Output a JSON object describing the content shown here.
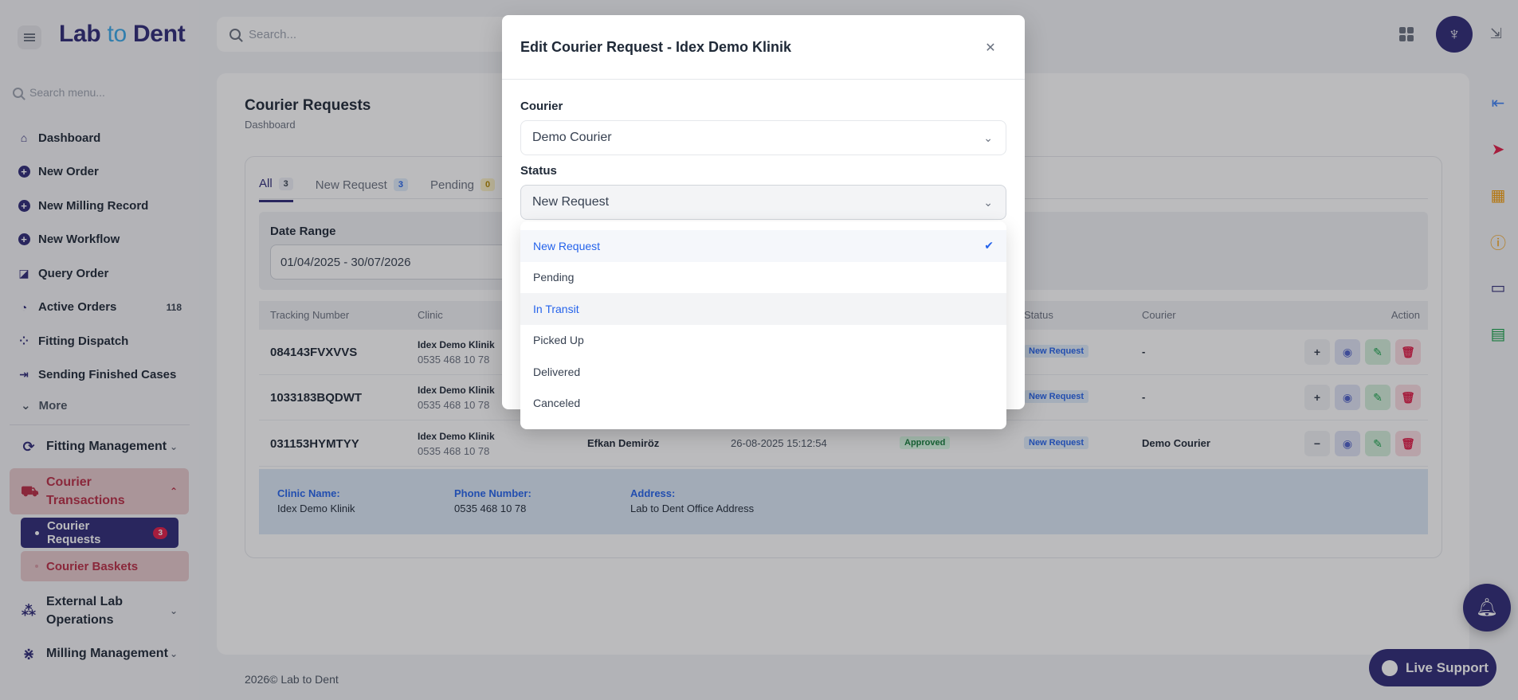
{
  "app": {
    "logo_main": "Lab ",
    "logo_to": "to",
    "logo_end": " Dent",
    "top_search_placeholder": "Search...",
    "avatar_icon": "tooth-icon"
  },
  "sidebar": {
    "search_placeholder": "Search menu...",
    "items": [
      {
        "label": "Dashboard",
        "icon": "home-icon"
      },
      {
        "label": "New Order",
        "icon": "plus-icon"
      },
      {
        "label": "New Milling Record",
        "icon": "plus-icon"
      },
      {
        "label": "New Workflow",
        "icon": "plus-icon"
      },
      {
        "label": "Query Order",
        "icon": "query-icon"
      },
      {
        "label": "Active Orders",
        "icon": "active-icon",
        "count": "118"
      },
      {
        "label": "Fitting Dispatch",
        "icon": "dispatch-icon"
      },
      {
        "label": "Sending Finished Cases",
        "icon": "send-icon"
      }
    ],
    "more_label": "More",
    "sections": {
      "fitting": "Fitting Management",
      "courier": "Courier Transactions",
      "external": "External Lab Operations",
      "milling": "Milling Management"
    },
    "courier_sub": {
      "requests": "Courier Requests",
      "requests_badge": "3",
      "baskets": "Courier Baskets"
    }
  },
  "page": {
    "title": "Courier Requests",
    "breadcrumb": "Dashboard",
    "tabs": [
      {
        "label": "All",
        "count": "3"
      },
      {
        "label": "New Request",
        "count": "3"
      },
      {
        "label": "Pending",
        "count": "0"
      }
    ],
    "filter": {
      "label": "Date Range",
      "value": "01/04/2025 - 30/07/2026"
    },
    "columns": {
      "tracking": "Tracking Number",
      "clinic": "Clinic",
      "status": "Status",
      "courier": "Courier",
      "action": "Action"
    },
    "rows": [
      {
        "tracking": "084143FVXVVS",
        "clinic": "Idex Demo Klinik",
        "phone": "0535 468 10 78",
        "status": "New Request",
        "courier": "-",
        "toggle": "+"
      },
      {
        "tracking": "1033183BQDWT",
        "clinic": "Idex Demo Klinik",
        "phone": "0535 468 10 78",
        "status": "New Request",
        "courier": "-",
        "toggle": "+"
      },
      {
        "tracking": "031153HYMTYY",
        "clinic": "Idex Demo Klinik",
        "phone": "0535 468 10 78",
        "created_by": "Efkan Demiröz",
        "date": "26-08-2025 15:12:54",
        "approval": "Approved",
        "status": "New Request",
        "courier": "Demo Courier",
        "toggle": "−"
      }
    ],
    "detail": {
      "clinic_label": "Clinic Name:",
      "clinic_value": "Idex Demo Klinik",
      "phone_label": "Phone Number:",
      "phone_value": "0535 468 10 78",
      "address_label": "Address:",
      "address_value": "Lab to Dent Office Address"
    },
    "footer_year": "2026©",
    "footer_name": "Lab to Dent",
    "live_support": "Live Support"
  },
  "modal": {
    "title": "Edit Courier Request - Idex Demo Klinik",
    "courier_label": "Courier",
    "courier_value": "Demo Courier",
    "status_label": "Status",
    "status_value": "New Request",
    "options": [
      "New Request",
      "Pending",
      "In Transit",
      "Picked Up",
      "Delivered",
      "Canceled"
    ],
    "selected_option": "New Request",
    "hovered_option": "In Transit"
  },
  "colors": {
    "brand": "#2e2a78",
    "accent": "#3aa8e8",
    "danger": "#e11d48",
    "success": "#16a34a",
    "link": "#2563eb"
  }
}
